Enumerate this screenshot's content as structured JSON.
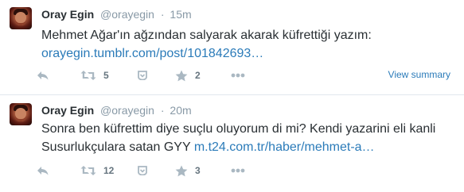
{
  "tweets": [
    {
      "fullname": "Oray Egin",
      "username": "@orayegin",
      "separator": "·",
      "time": "15m",
      "text_plain": "Mehmet Ağar'ın ağzından salyarak akarak küfrettiği yazım:",
      "link": "orayegin.tumblr.com/post/101842693…",
      "retweets": "5",
      "favorites": "2",
      "view_summary": "View summary"
    },
    {
      "fullname": "Oray Egin",
      "username": "@orayegin",
      "separator": "·",
      "time": "20m",
      "text_plain": "Sonra ben küfrettim diye suçlu oluyorum di mi? Kendi yazarini eli kanli Susurlukçulara satan GYY",
      "link": "m.t24.com.tr/haber/mehmet-a…",
      "retweets": "12",
      "favorites": "3"
    }
  ],
  "colors": {
    "text": "#292f33",
    "secondary": "#8899a6",
    "link": "#2b7bb9",
    "icon": "#aab8c2",
    "divider": "#e1e8ed"
  },
  "icons": [
    "reply-icon",
    "retweet-icon",
    "save-icon",
    "favorite-star-icon",
    "more-icon"
  ]
}
